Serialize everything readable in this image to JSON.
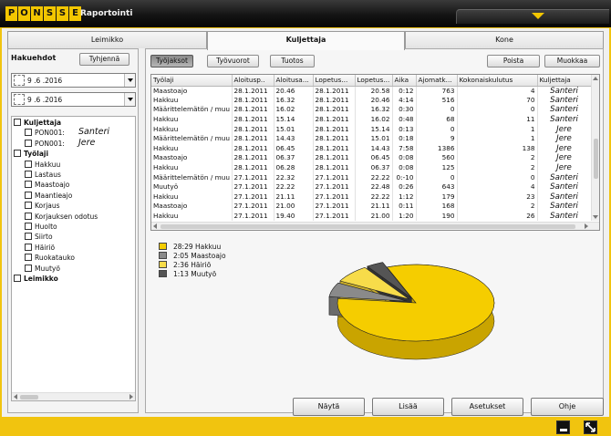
{
  "app": {
    "logo_letters": [
      "P",
      "O",
      "N",
      "S",
      "S",
      "E"
    ],
    "title": "Raportointi"
  },
  "tabs": [
    {
      "label": "Leimikko",
      "active": false
    },
    {
      "label": "Kuljettaja",
      "active": true
    },
    {
      "label": "Kone",
      "active": false
    }
  ],
  "filters": {
    "heading": "Hakuehdot",
    "clear_button": "Tyhjennä",
    "date_from": "9 .6 .2016",
    "date_to": "9 .6 .2016",
    "tree": [
      {
        "label": "Kuljettaja",
        "bold": true,
        "indent": 0
      },
      {
        "label": "PON001:",
        "bold": false,
        "indent": 1,
        "operator": "Santeri"
      },
      {
        "label": "PON001:",
        "bold": false,
        "indent": 1,
        "operator": "Jere"
      },
      {
        "label": "Työlaji",
        "bold": true,
        "indent": 0
      },
      {
        "label": "Hakkuu",
        "bold": false,
        "indent": 1
      },
      {
        "label": "Lastaus",
        "bold": false,
        "indent": 1
      },
      {
        "label": "Maastoajo",
        "bold": false,
        "indent": 1
      },
      {
        "label": "Maantieajo",
        "bold": false,
        "indent": 1
      },
      {
        "label": "Korjaus",
        "bold": false,
        "indent": 1
      },
      {
        "label": "Korjauksen odotus",
        "bold": false,
        "indent": 1
      },
      {
        "label": "Huolto",
        "bold": false,
        "indent": 1
      },
      {
        "label": "Siirto",
        "bold": false,
        "indent": 1
      },
      {
        "label": "Häiriö",
        "bold": false,
        "indent": 1
      },
      {
        "label": "Ruokatauko",
        "bold": false,
        "indent": 1
      },
      {
        "label": "Muutyö",
        "bold": false,
        "indent": 1
      },
      {
        "label": "Leimikko",
        "bold": true,
        "indent": 0
      }
    ]
  },
  "view_buttons": {
    "work_periods": "Työjaksot",
    "shifts": "Työvuorot",
    "output": "Tuotos",
    "delete": "Poista",
    "edit": "Muokkaa"
  },
  "table": {
    "columns": [
      "Työlaji",
      "Aloitusp..",
      "Aloitusa...",
      "Lopetus...",
      "Lopetus...",
      "Aika",
      "Ajomatk...",
      "Kokonaiskulutus",
      "Kuljettaja"
    ],
    "rows": [
      [
        "Maastoajo",
        "28.1.2011",
        "20.46",
        "28.1.2011",
        "20.58",
        "0:12",
        "763",
        "4",
        "Santeri"
      ],
      [
        "Hakkuu",
        "28.1.2011",
        "16.32",
        "28.1.2011",
        "20.46",
        "4:14",
        "516",
        "70",
        "Santeri"
      ],
      [
        "Määrittelemätön / muu",
        "28.1.2011",
        "16.02",
        "28.1.2011",
        "16.32",
        "0:30",
        "0",
        "0",
        "Santeri"
      ],
      [
        "Hakkuu",
        "28.1.2011",
        "15.14",
        "28.1.2011",
        "16.02",
        "0:48",
        "68",
        "11",
        "Santeri"
      ],
      [
        "Hakkuu",
        "28.1.2011",
        "15.01",
        "28.1.2011",
        "15.14",
        "0:13",
        "0",
        "1",
        "Jere"
      ],
      [
        "Määrittelemätön / muu",
        "28.1.2011",
        "14.43",
        "28.1.2011",
        "15.01",
        "0:18",
        "9",
        "1",
        "Jere"
      ],
      [
        "Hakkuu",
        "28.1.2011",
        "06.45",
        "28.1.2011",
        "14.43",
        "7:58",
        "1386",
        "138",
        "Jere"
      ],
      [
        "Maastoajo",
        "28.1.2011",
        "06.37",
        "28.1.2011",
        "06.45",
        "0:08",
        "560",
        "2",
        "Jere"
      ],
      [
        "Hakkuu",
        "28.1.2011",
        "06.28",
        "28.1.2011",
        "06.37",
        "0:08",
        "125",
        "2",
        "Jere"
      ],
      [
        "Määrittelemätön / muu",
        "27.1.2011",
        "22.32",
        "27.1.2011",
        "22.22",
        "0:-10",
        "0",
        "0",
        "Santeri"
      ],
      [
        "Muutyö",
        "27.1.2011",
        "22.22",
        "27.1.2011",
        "22.48",
        "0:26",
        "643",
        "4",
        "Santeri"
      ],
      [
        "Hakkuu",
        "27.1.2011",
        "21.11",
        "27.1.2011",
        "22.22",
        "1:12",
        "179",
        "23",
        "Santeri"
      ],
      [
        "Maastoajo",
        "27.1.2011",
        "21.00",
        "27.1.2011",
        "21.11",
        "0:11",
        "168",
        "2",
        "Santeri"
      ],
      [
        "Hakkuu",
        "27.1.2011",
        "19.40",
        "27.1.2011",
        "21.00",
        "1:20",
        "190",
        "26",
        "Santeri"
      ]
    ]
  },
  "chart_data": {
    "type": "pie",
    "categories": [
      "Hakkuu",
      "Maastoajo",
      "Häiriö",
      "Muutyö"
    ],
    "legend_labels": [
      "28:29 Hakkuu",
      "2:05 Maastoajo",
      "2:36 Häiriö",
      "1:13 Muutyö"
    ],
    "values_minutes": [
      1709,
      125,
      156,
      73
    ],
    "colors": [
      "#f5cd00",
      "#8a8a8a",
      "#f7dc4a",
      "#555555"
    ]
  },
  "bottom_buttons": {
    "show": "Näytä",
    "add": "Lisää",
    "settings": "Asetukset",
    "help": "Ohje"
  },
  "colors": {
    "brand_yellow": "#f1c40f",
    "logo_yellow": "#f3c600"
  }
}
